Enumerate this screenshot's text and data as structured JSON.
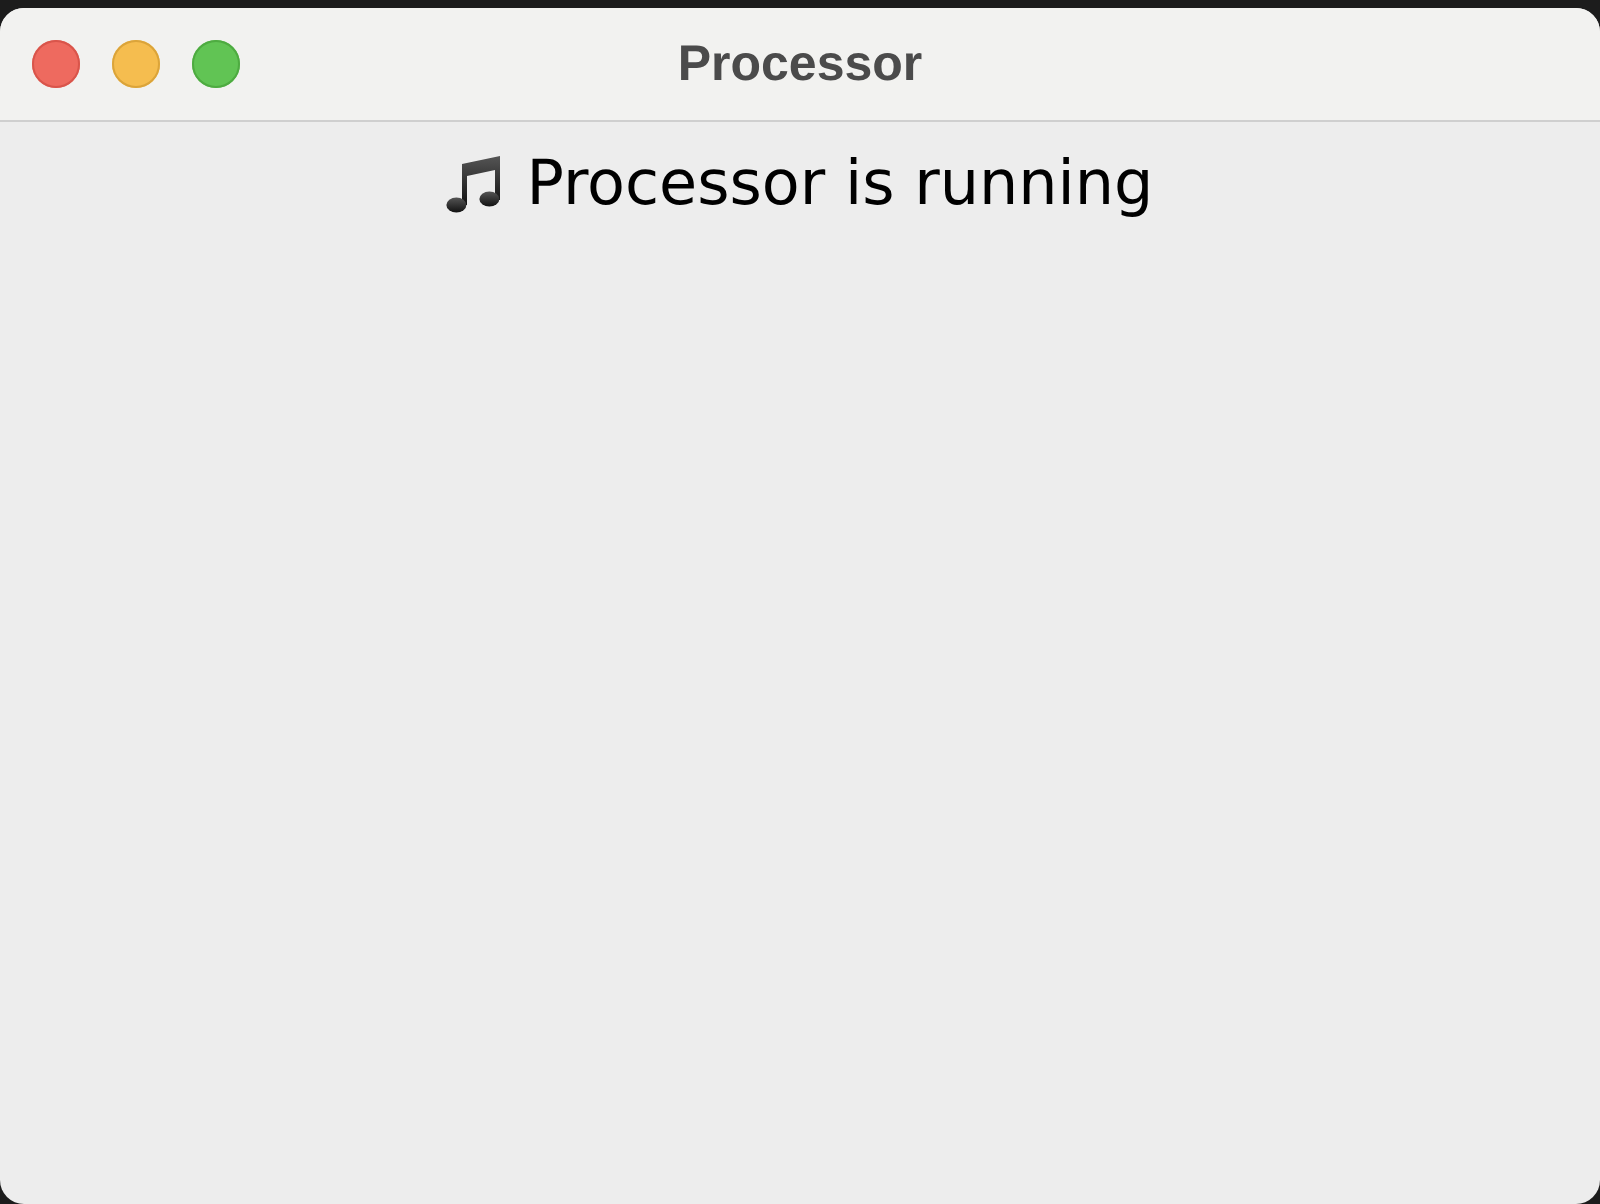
{
  "window": {
    "title": "Processor"
  },
  "status": {
    "message": "Processor is running"
  }
}
